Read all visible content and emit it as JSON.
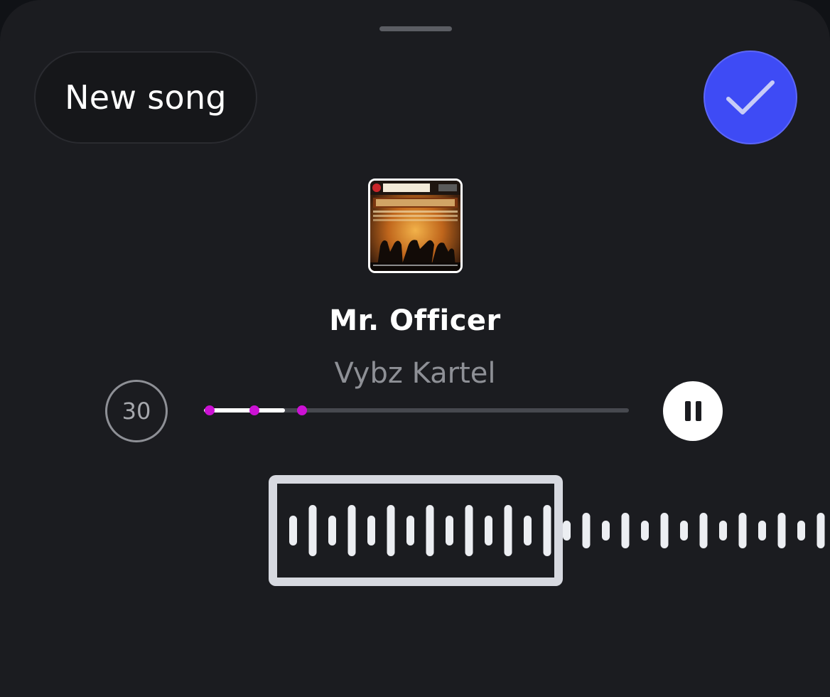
{
  "header": {
    "new_song_label": "New song",
    "confirm_icon": "checkmark-icon"
  },
  "track": {
    "title": "Mr. Officer",
    "artist": "Vybz Kartel",
    "album_art": "album-art"
  },
  "player": {
    "clip_duration": "30",
    "progress_fraction": 0.19,
    "marker_fractions": [
      0.013,
      0.118,
      0.23
    ],
    "pause_icon": "pause-icon"
  },
  "colors": {
    "accent_blue": "#3e4bf5",
    "marker_magenta": "#cc11d4",
    "background": "#1b1c20"
  }
}
